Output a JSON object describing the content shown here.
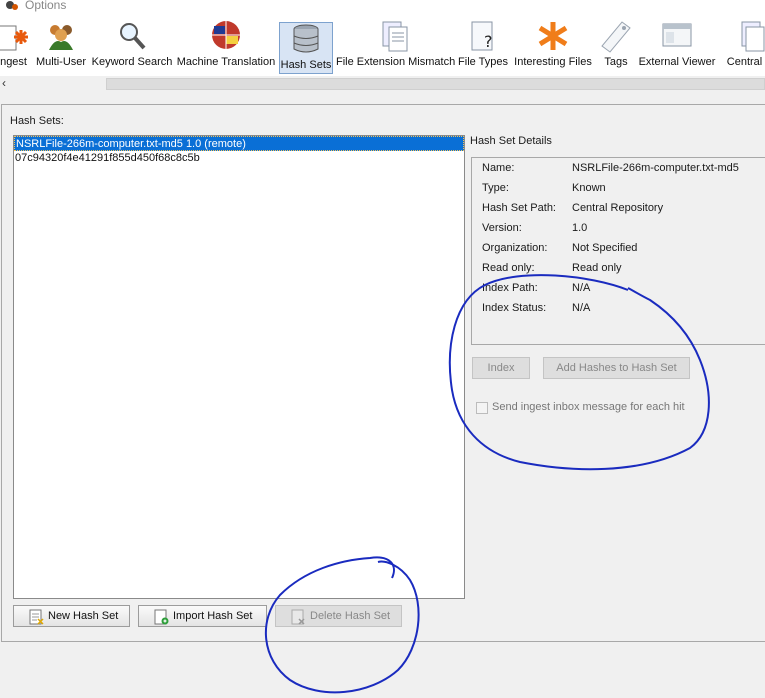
{
  "window": {
    "title": "Options"
  },
  "toolbar": {
    "items": [
      {
        "label": "Ingest",
        "icon": "ingest-icon"
      },
      {
        "label": "Multi-User",
        "icon": "users-icon"
      },
      {
        "label": "Keyword Search",
        "icon": "magnifier-icon"
      },
      {
        "label": "Machine Translation",
        "icon": "globe-flags-icon"
      },
      {
        "label": "Hash Sets",
        "icon": "database-icon",
        "selected": true
      },
      {
        "label": "File Extension Mismatch",
        "icon": "documents-icon"
      },
      {
        "label": "File Types",
        "icon": "file-question-icon"
      },
      {
        "label": "Interesting Files",
        "icon": "asterisk-icon"
      },
      {
        "label": "Tags",
        "icon": "tag-icon"
      },
      {
        "label": "External Viewer",
        "icon": "window-icon"
      },
      {
        "label": "Central R",
        "icon": "documents-icon"
      }
    ]
  },
  "hash_sets": {
    "label": "Hash Sets:",
    "items": [
      {
        "text": "NSRLFile-266m-computer.txt-md5 1.0 (remote)",
        "selected": true
      },
      {
        "text": "07c94320f4e41291f855d450f68c8c5b",
        "selected": false
      }
    ]
  },
  "details": {
    "title": "Hash Set Details",
    "fields": [
      {
        "label": "Name:",
        "value": "NSRLFile-266m-computer.txt-md5"
      },
      {
        "label": "Type:",
        "value": "Known"
      },
      {
        "label": "Hash Set Path:",
        "value": "Central Repository"
      },
      {
        "label": "Version:",
        "value": "1.0"
      },
      {
        "label": "Organization:",
        "value": "Not Specified"
      },
      {
        "label": "Read only:",
        "value": "Read only"
      },
      {
        "label": "Index Path:",
        "value": "N/A"
      },
      {
        "label": "Index Status:",
        "value": "N/A"
      }
    ]
  },
  "buttons": {
    "index": "Index",
    "add_hashes": "Add Hashes to Hash Set",
    "new_hash_set": "New Hash Set",
    "import_hash_set": "Import Hash Set",
    "delete_hash_set": "Delete Hash Set"
  },
  "ingest_option": {
    "label": "Send ingest inbox message for each hit",
    "checked": false,
    "enabled": false
  },
  "colors": {
    "selection": "#0a6fd6",
    "annotation": "#1a2bbf",
    "toolbar_selected": "#d8e4f4"
  }
}
